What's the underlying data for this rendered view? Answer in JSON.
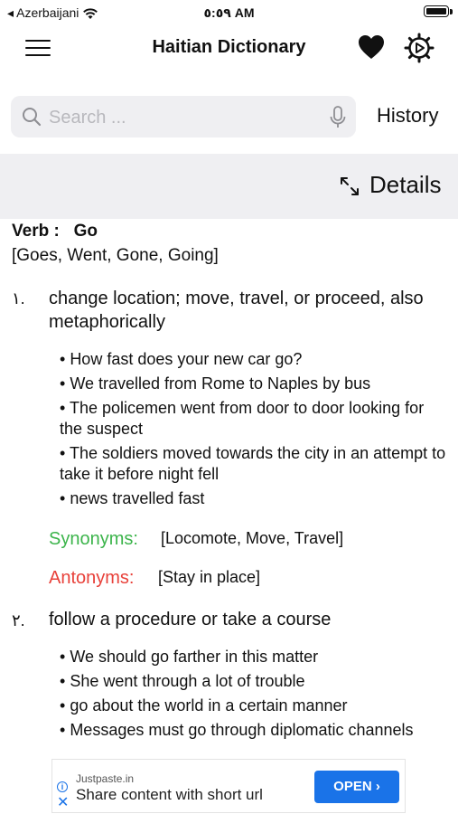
{
  "status_bar": {
    "carrier": "◂ Azerbaijani",
    "time": "٥:٥٩ AM"
  },
  "navbar": {
    "title": "Haitian Dictionary"
  },
  "search": {
    "placeholder": "Search ...",
    "value": ""
  },
  "history_label": "History",
  "details_label": "Details",
  "entry": {
    "pos": "Verb :",
    "word": "Go",
    "forms": "[Goes, Went, Gone, Going]",
    "senses": [
      {
        "number": "١.",
        "definition": "change location; move, travel, or proceed, also metaphorically",
        "examples": [
          "How fast does your new car go?",
          "We travelled from Rome to Naples by bus",
          "The policemen went from door to door looking for the suspect",
          "The soldiers moved towards the city in an attempt to take it before night fell",
          "news travelled fast"
        ],
        "synonyms_label": "Synonyms:",
        "synonyms": "[Locomote, Move, Travel]",
        "antonyms_label": "Antonyms:",
        "antonyms": "[Stay in place]"
      },
      {
        "number": "٢.",
        "definition": "follow a procedure or take a course",
        "examples": [
          "We should go farther in this matter",
          "She went through a lot of trouble",
          "go about the world in a certain manner",
          "Messages must go through diplomatic channels"
        ]
      }
    ]
  },
  "ad": {
    "source": "Justpaste.in",
    "text": "Share content with short url",
    "button": "OPEN ›"
  },
  "colors": {
    "synonyms": "#3cb44b",
    "antonyms": "#e8413a",
    "ad_button": "#1a73e8",
    "search_bg": "#efeff2"
  }
}
